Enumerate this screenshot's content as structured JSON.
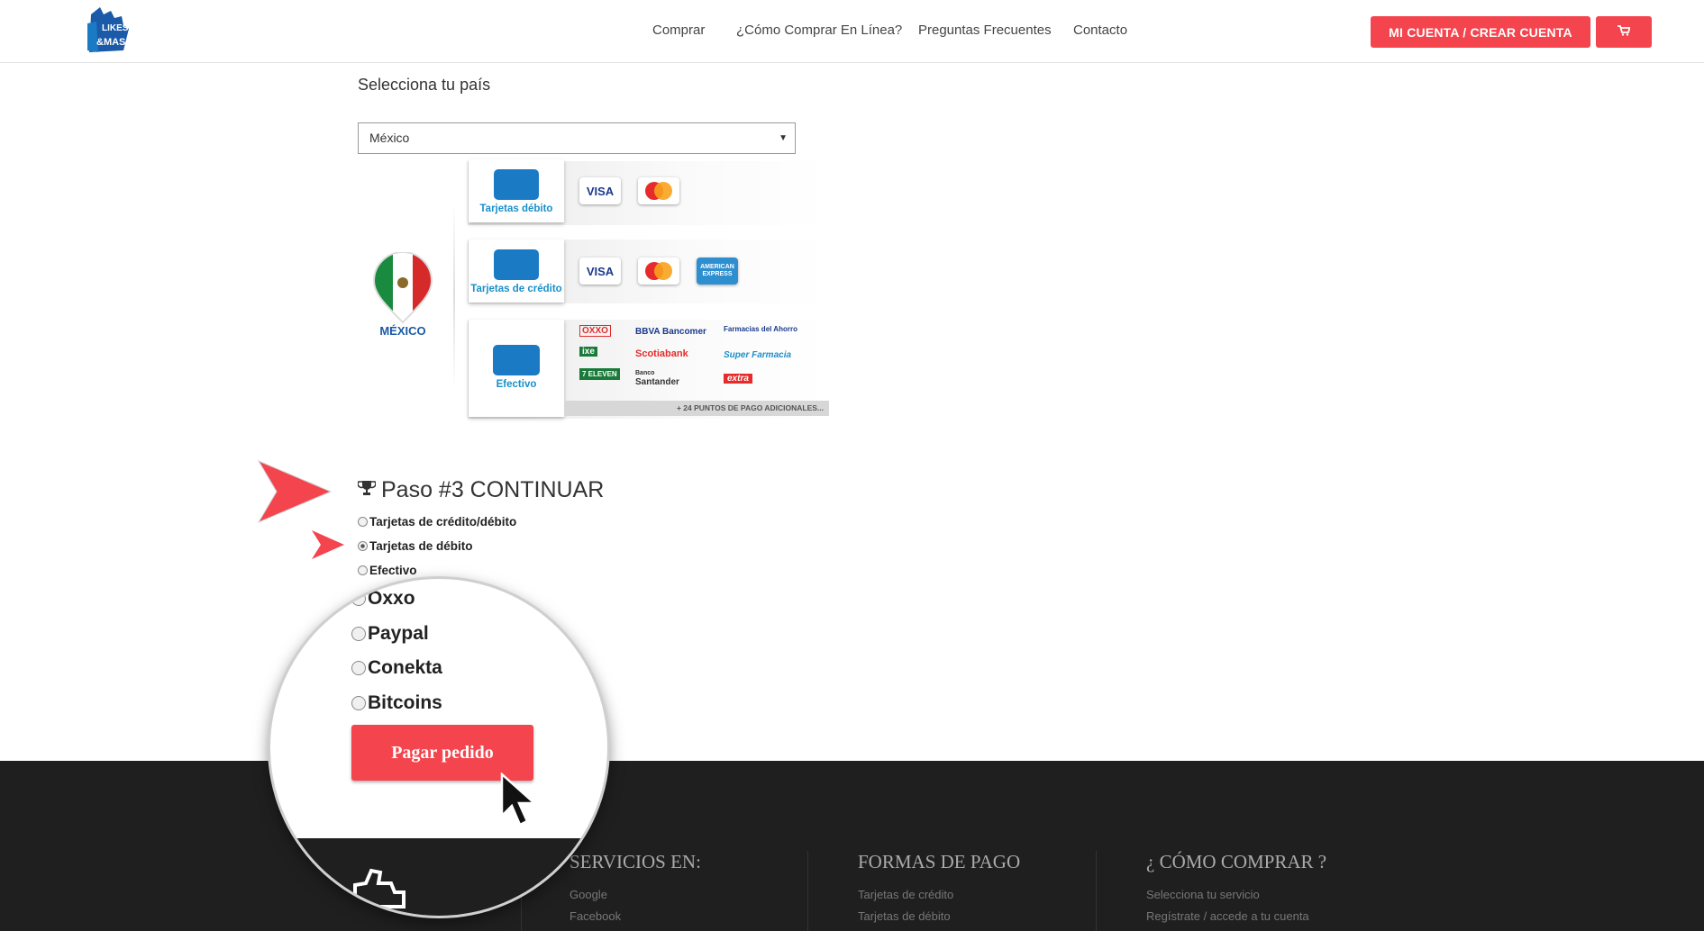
{
  "header": {
    "logo_alt": "Likes & Más",
    "logo_text_top": "LIKES",
    "logo_text_bottom": "&MAS",
    "nav": [
      {
        "label": "Comprar"
      },
      {
        "label": "¿Cómo Comprar En Línea?"
      },
      {
        "label": "Preguntas Frecuentes"
      },
      {
        "label": "Contacto"
      }
    ],
    "account_button": "MI CUENTA / CREAR CUENTA",
    "cart_icon": "shopping-cart-icon"
  },
  "country": {
    "label": "Selecciona tu país",
    "selected": "México"
  },
  "payment_graphic": {
    "country_name": "MÉXICO",
    "debit_label": "Tarjetas débito",
    "credit_label": "Tarjetas de crédito",
    "cash_label": "Efectivo",
    "card_brands": {
      "visa": "VISA",
      "mastercard": "MasterCard",
      "amex": "AMERICAN EXPRESS"
    },
    "stores": [
      "OXXO",
      "ixe",
      "7 ELEVEN",
      "BBVA Bancomer",
      "Scotiabank",
      "Santander",
      "Banco",
      "Farmacias del Ahorro",
      "Super Farmacia",
      "extra"
    ],
    "extra_points": "+ 24 PUNTOS DE PAGO ADICIONALES..."
  },
  "step3": {
    "title": "Paso #3 CONTINUAR",
    "options": [
      {
        "label": "Tarjetas de crédito/débito",
        "selected": false
      },
      {
        "label": "Tarjetas de débito",
        "selected": true
      },
      {
        "label": "Efectivo",
        "selected": false
      }
    ]
  },
  "magnifier": {
    "options": [
      "Oxxo",
      "Paypal",
      "Conekta",
      "Bitcoins"
    ],
    "pay_button": "Pagar pedido"
  },
  "footer": {
    "columns": [
      {
        "heading": "SERVICIOS EN:",
        "links": [
          "Google",
          "Facebook"
        ]
      },
      {
        "heading": "FORMAS DE PAGO",
        "links": [
          "Tarjetas de crédito",
          "Tarjetas de débito"
        ]
      },
      {
        "heading": "¿ CÓMO COMPRAR ?",
        "links": [
          "Selecciona tu servicio",
          "Regístrate / accede a tu cuenta"
        ]
      }
    ]
  },
  "colors": {
    "accent": "#f4444d",
    "footer_bg": "#1f1f1f",
    "brand_blue": "#1a7bc4"
  }
}
